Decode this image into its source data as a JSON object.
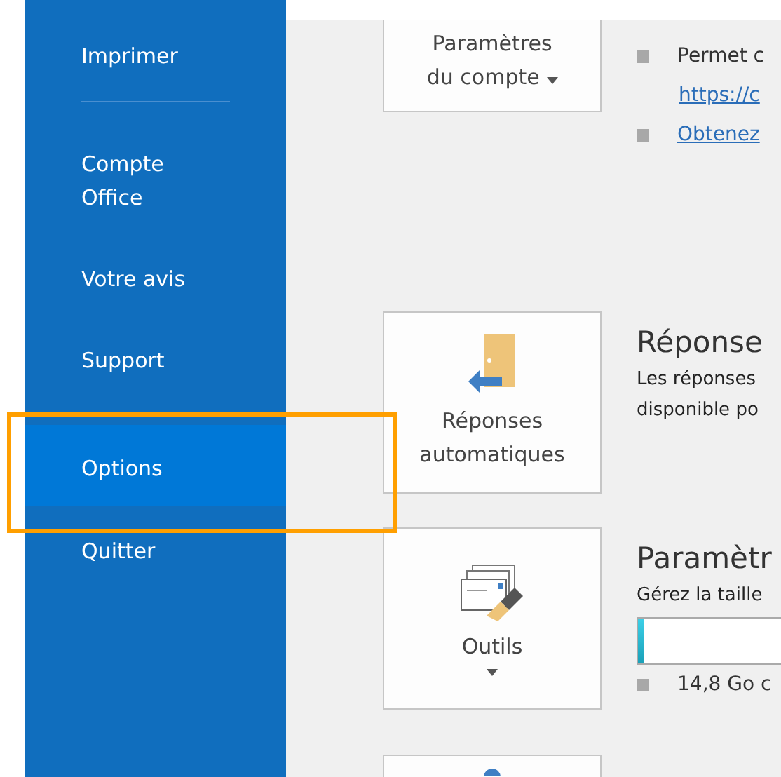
{
  "sidebar": {
    "items": [
      {
        "label": "Imprimer",
        "selected": false,
        "divider_after": true
      },
      {
        "label": "Compte\nOffice",
        "selected": false
      },
      {
        "label": "Votre avis",
        "selected": false
      },
      {
        "label": "Support",
        "selected": false
      },
      {
        "label": "Options",
        "selected": true
      },
      {
        "label": "Quitter",
        "selected": false
      }
    ]
  },
  "sections": [
    {
      "kind": "account",
      "button": {
        "label": "Paramètres\ndu compte",
        "dropdown": true
      },
      "bullets": [
        {
          "text": "Permet c",
          "link": false,
          "continuation": {
            "text": "https://c",
            "link": true
          }
        },
        {
          "text": "Obtenez",
          "link": true
        }
      ]
    },
    {
      "kind": "autoreply",
      "button": {
        "label": "Réponses\nautomatiques"
      },
      "heading": "Réponse",
      "lines": [
        "Les réponses",
        "disponible po"
      ]
    },
    {
      "kind": "tools",
      "button": {
        "label": "Outils",
        "dropdown": true
      },
      "heading": "Paramètr",
      "lines": [
        "Gérez la taille"
      ],
      "storage": {
        "level": 0.03
      },
      "bullets": [
        {
          "text": "14,8 Go c",
          "link": false
        }
      ]
    },
    {
      "kind": "rules"
    }
  ]
}
